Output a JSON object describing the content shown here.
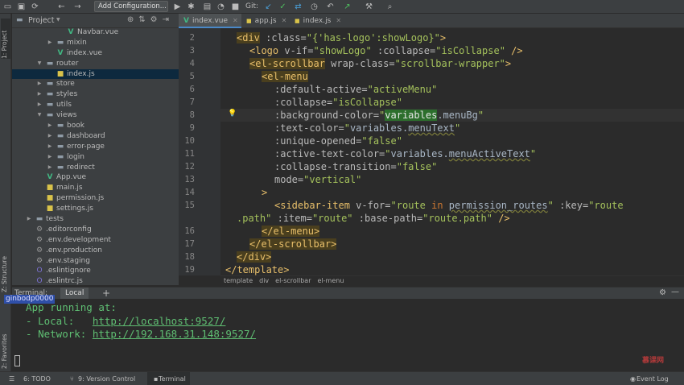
{
  "toolbar": {
    "add_configuration": "Add Configuration...",
    "git_label": "Git:"
  },
  "left_strip": {
    "project_tab": "1: Project",
    "structure_tab": "Z: Structure",
    "favorites_tab": "2: Favorites"
  },
  "project_panel": {
    "title": "Project",
    "tree": [
      {
        "label": "Navbar.vue",
        "type": "vue",
        "depth": 4
      },
      {
        "label": "mixin",
        "type": "folder",
        "depth": 3,
        "expandable": true
      },
      {
        "label": "index.vue",
        "type": "vue",
        "depth": 3
      },
      {
        "label": "router",
        "type": "folder",
        "depth": 2,
        "expanded": true
      },
      {
        "label": "index.js",
        "type": "js",
        "depth": 3,
        "selected": true
      },
      {
        "label": "store",
        "type": "folder",
        "depth": 2,
        "expandable": true
      },
      {
        "label": "styles",
        "type": "folder",
        "depth": 2,
        "expandable": true
      },
      {
        "label": "utils",
        "type": "folder",
        "depth": 2,
        "expandable": true
      },
      {
        "label": "views",
        "type": "folder",
        "depth": 2,
        "expanded": true
      },
      {
        "label": "book",
        "type": "folder",
        "depth": 3,
        "expandable": true
      },
      {
        "label": "dashboard",
        "type": "folder",
        "depth": 3,
        "expandable": true
      },
      {
        "label": "error-page",
        "type": "folder",
        "depth": 3,
        "expandable": true
      },
      {
        "label": "login",
        "type": "folder",
        "depth": 3,
        "expandable": true
      },
      {
        "label": "redirect",
        "type": "folder",
        "depth": 3,
        "expandable": true
      },
      {
        "label": "App.vue",
        "type": "vue",
        "depth": 2
      },
      {
        "label": "main.js",
        "type": "js",
        "depth": 2
      },
      {
        "label": "permission.js",
        "type": "js",
        "depth": 2
      },
      {
        "label": "settings.js",
        "type": "js",
        "depth": 2
      },
      {
        "label": "tests",
        "type": "folder",
        "depth": 1,
        "expandable": true
      },
      {
        "label": ".editorconfig",
        "type": "cfg",
        "depth": 1
      },
      {
        "label": ".env.development",
        "type": "cfg",
        "depth": 1
      },
      {
        "label": ".env.production",
        "type": "cfg",
        "depth": 1
      },
      {
        "label": ".env.staging",
        "type": "cfg",
        "depth": 1
      },
      {
        "label": ".eslintignore",
        "type": "eslint",
        "depth": 1
      },
      {
        "label": ".eslintrc.js",
        "type": "eslint",
        "depth": 1
      }
    ]
  },
  "editor_tabs": [
    {
      "label": "index.vue",
      "type": "vue",
      "active": true
    },
    {
      "label": "app.js",
      "type": "js",
      "active": false
    },
    {
      "label": "index.js",
      "type": "js",
      "active": false
    }
  ],
  "line_numbers": [
    "2",
    "3",
    "4",
    "5",
    "6",
    "7",
    "8",
    "9",
    "10",
    "11",
    "12",
    "13",
    "14",
    "15",
    "",
    "16",
    "17",
    "18",
    "19"
  ],
  "breadcrumb": [
    "template",
    "div",
    "el-scrollbar",
    "el-menu"
  ],
  "terminal": {
    "title": "Terminal:",
    "tab": "Local",
    "add": "+",
    "prompt_label": "ginbodp0000",
    "lines": {
      "running": "  App running at:",
      "local_label": "  - Local:   ",
      "local_url": "http://localhost:9527/",
      "network_label": "  - Network: ",
      "network_url": "http://192.168.31.148:9527/"
    }
  },
  "statusbar": {
    "todo": "6: TODO",
    "version_control": "9: Version Control",
    "terminal": "Terminal",
    "event_log": "Event Log"
  },
  "watermark": "慕课网"
}
